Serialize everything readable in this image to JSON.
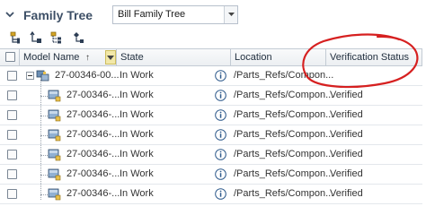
{
  "header": {
    "title": "Family Tree",
    "view_selected": "Bill Family Tree"
  },
  "columns": [
    {
      "label": "Model Name"
    },
    {
      "label": "State"
    },
    {
      "label": "Location"
    },
    {
      "label": "Verification Status"
    }
  ],
  "sort_indicator": "↑",
  "rows": [
    {
      "model": "27-00346-00...",
      "state": "In Work",
      "location": "/Parts_Refs/Compon...",
      "status": ""
    },
    {
      "model": "27-00346-...",
      "state": "In Work",
      "location": "/Parts_Refs/Compon...",
      "status": "Verified"
    },
    {
      "model": "27-00346-...",
      "state": "In Work",
      "location": "/Parts_Refs/Compon...",
      "status": "Verified"
    },
    {
      "model": "27-00346-...",
      "state": "In Work",
      "location": "/Parts_Refs/Compon...",
      "status": "Verified"
    },
    {
      "model": "27-00346-...",
      "state": "In Work",
      "location": "/Parts_Refs/Compon...",
      "status": "Verified"
    },
    {
      "model": "27-00346-...",
      "state": "In Work",
      "location": "/Parts_Refs/Compon...",
      "status": "Verified"
    },
    {
      "model": "27-00346-...",
      "state": "In Work",
      "location": "/Parts_Refs/Compon...",
      "status": "Verified"
    }
  ],
  "toolbar_icons": [
    "tree-structure-icon",
    "move-node-icon",
    "list-tree-icon",
    "expand-node-icon"
  ],
  "annotation_color": "#d62020"
}
